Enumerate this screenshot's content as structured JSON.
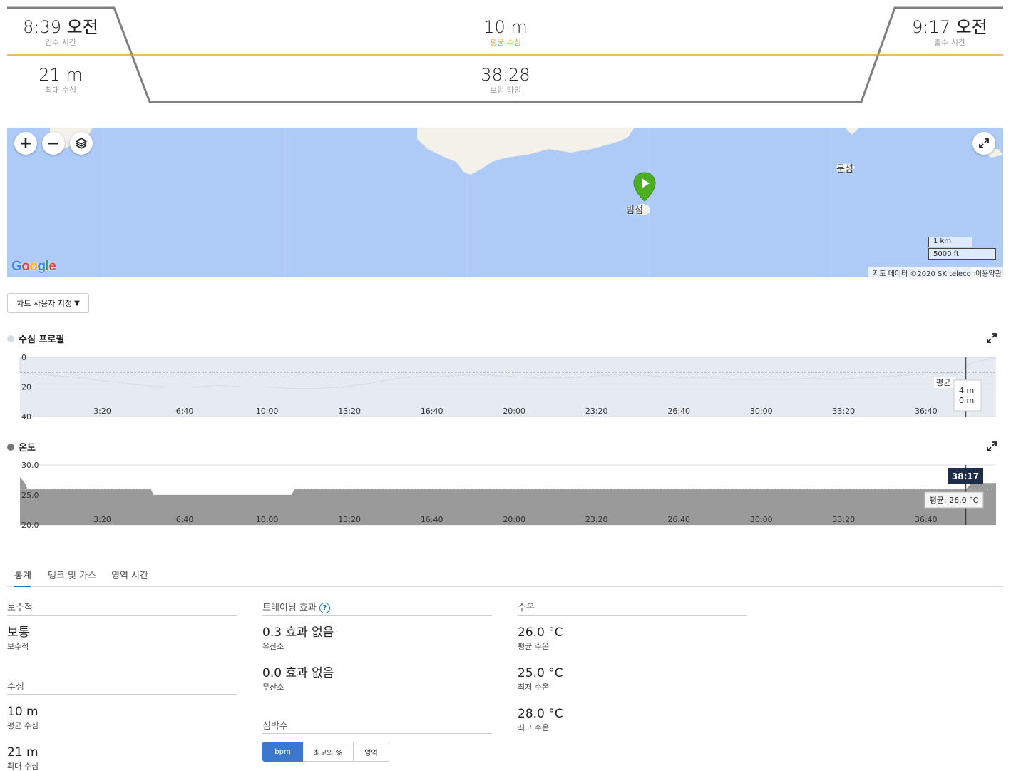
{
  "summary": {
    "entry_time": "8:39 오전",
    "entry_time_label": "입수 시간",
    "avg_depth": "10 m",
    "avg_depth_label": "평균 수심",
    "exit_time": "9:17 오전",
    "exit_time_label": "출수 시간",
    "max_depth": "21 m",
    "max_depth_label": "최대 수심",
    "bottom_time": "38:28",
    "bottom_time_label": "보텀 타임"
  },
  "map": {
    "zoom_in": "+",
    "zoom_out": "−",
    "place_beomseom": "범섬",
    "place_munseom": "문섬",
    "scale_km": "1 km",
    "scale_ft": "5000 ft",
    "logo": "Google",
    "attribution": "지도 데이터 ©2020 SK telecom",
    "terms": "이용약관"
  },
  "chart_customize": "차트 사용자 지정",
  "chart_data": [
    {
      "type": "area",
      "title": "수심 프로필",
      "x_ticks": [
        "3:20",
        "6:40",
        "10:00",
        "13:20",
        "16:40",
        "20:00",
        "23:20",
        "26:40",
        "30:00",
        "33:20",
        "36:40"
      ],
      "y_ticks": [
        "0",
        "20",
        "40"
      ],
      "ylim": [
        0,
        40
      ],
      "y_inverted": true,
      "x": [
        0,
        1,
        2,
        3,
        4,
        5,
        6,
        7,
        8,
        9,
        10,
        11,
        12,
        13,
        14,
        15,
        16,
        17,
        18,
        19,
        20,
        21,
        22,
        23,
        24,
        25,
        26,
        27,
        28,
        29,
        30,
        31,
        32,
        33,
        34,
        35,
        36,
        37,
        38,
        38.5
      ],
      "values": [
        10,
        12,
        13,
        15,
        17,
        19,
        20,
        20,
        19,
        20,
        20,
        21,
        21,
        20,
        18,
        15,
        13,
        13,
        12,
        12,
        13,
        14,
        14,
        13,
        12,
        12,
        13,
        14,
        14,
        15,
        15,
        15,
        14,
        15,
        14,
        13,
        12,
        11,
        10,
        4
      ],
      "average": 10,
      "average_label": "평균",
      "tooltip": [
        "4 m",
        "0 m"
      ],
      "cursor_x": 38.28
    },
    {
      "type": "area",
      "title": "온도",
      "x_ticks": [
        "3:20",
        "6:40",
        "10:00",
        "13:20",
        "16:40",
        "20:00",
        "23:20",
        "26:40",
        "30:00",
        "33:20",
        "36:40"
      ],
      "y_ticks": [
        "30.0",
        "25.0",
        "20.0"
      ],
      "ylim": [
        20,
        30
      ],
      "x": [
        0,
        0.2,
        0.3,
        1.2,
        1.4,
        5.3,
        5.4,
        11.0,
        11.1,
        38.3,
        38.5
      ],
      "values": [
        28,
        27,
        26,
        26,
        26,
        26,
        25,
        25,
        26,
        26,
        27
      ],
      "average": 26.0,
      "average_label": "평균: 26.0 °C",
      "cursor_label": "38:17",
      "cursor_x": 38.28
    }
  ],
  "chart_labels": {
    "depth_avg_text": "평균",
    "depth_avg_value": "10 m",
    "depth_tooltip_1": "4 m",
    "depth_tooltip_2": "0 m",
    "temp_cursor": "38:17",
    "temp_avg": "평균: 26.0 °C"
  },
  "tabs": [
    "통계",
    "탱크 및 가스",
    "영역 시간"
  ],
  "stats": {
    "conservatism_header": "보수적",
    "conservatism_value": "보통",
    "conservatism_label": "보수적",
    "depth_header": "수심",
    "avg_depth_value": "10 m",
    "avg_depth_label": "평균 수심",
    "max_depth_value": "21 m",
    "max_depth_label": "최대 수심",
    "training_header": "트레이닝 효과",
    "help": "?",
    "aerobic_value": "0.3 효과 없음",
    "aerobic_label": "유산소",
    "anaerobic_value": "0.0 효과 없음",
    "anaerobic_label": "무산소",
    "hr_header": "심박수",
    "hr_opts": [
      "bpm",
      "최고의 %",
      "영역"
    ],
    "water_header": "수온",
    "avg_temp_value": "26.0 °C",
    "avg_temp_label": "평균 수온",
    "min_temp_value": "25.0 °C",
    "min_temp_label": "최저 수온",
    "max_temp_value": "28.0 °C",
    "max_temp_label": "최고 수온"
  }
}
